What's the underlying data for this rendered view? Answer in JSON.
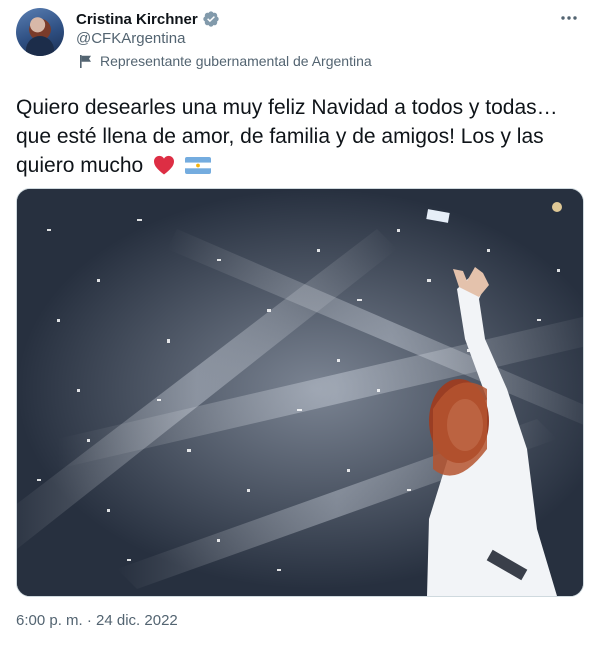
{
  "author": {
    "display_name": "Cristina Kirchner",
    "handle": "@CFKArgentina",
    "verified": true,
    "label": "Representante gubernamental de Argentina",
    "label_icon": "flag-icon"
  },
  "tweet": {
    "text": "Quiero desearles una muy feliz Navidad a todos y todas… que esté llena de amor, de familia y de amigos! Los y las quiero mucho",
    "emojis": [
      "red-heart",
      "argentina-flag"
    ],
    "timestamp": "6:00 p. m. · 24 dic. 2022"
  },
  "colors": {
    "accent": "#1d9bf0",
    "secondary_text": "#536471",
    "heart": "#e0245e",
    "flag_blue": "#74acdf",
    "sun": "#f6b40e"
  }
}
